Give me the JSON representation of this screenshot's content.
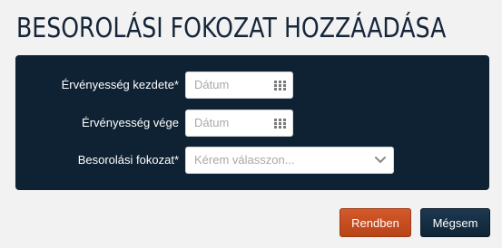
{
  "dialog": {
    "title": "BESOROLÁSI FOKOZAT HOZZÁADÁSA"
  },
  "form": {
    "valid_from": {
      "label": "Érvényesség kezdete*",
      "placeholder": "Dátum",
      "icon": "calendar-icon"
    },
    "valid_to": {
      "label": "Érvényesség vége",
      "placeholder": "Dátum",
      "icon": "calendar-icon"
    },
    "grade": {
      "label": "Besorolási fokozat*",
      "placeholder": "Kérem válasszon...",
      "icon": "chevron-down-icon"
    }
  },
  "actions": {
    "ok_label": "Rendben",
    "cancel_label": "Mégsem"
  },
  "colors": {
    "panel_bg": "#0e2233",
    "title_text": "#16263a",
    "ok_button": "#c84d1f",
    "cancel_button": "#163048"
  }
}
